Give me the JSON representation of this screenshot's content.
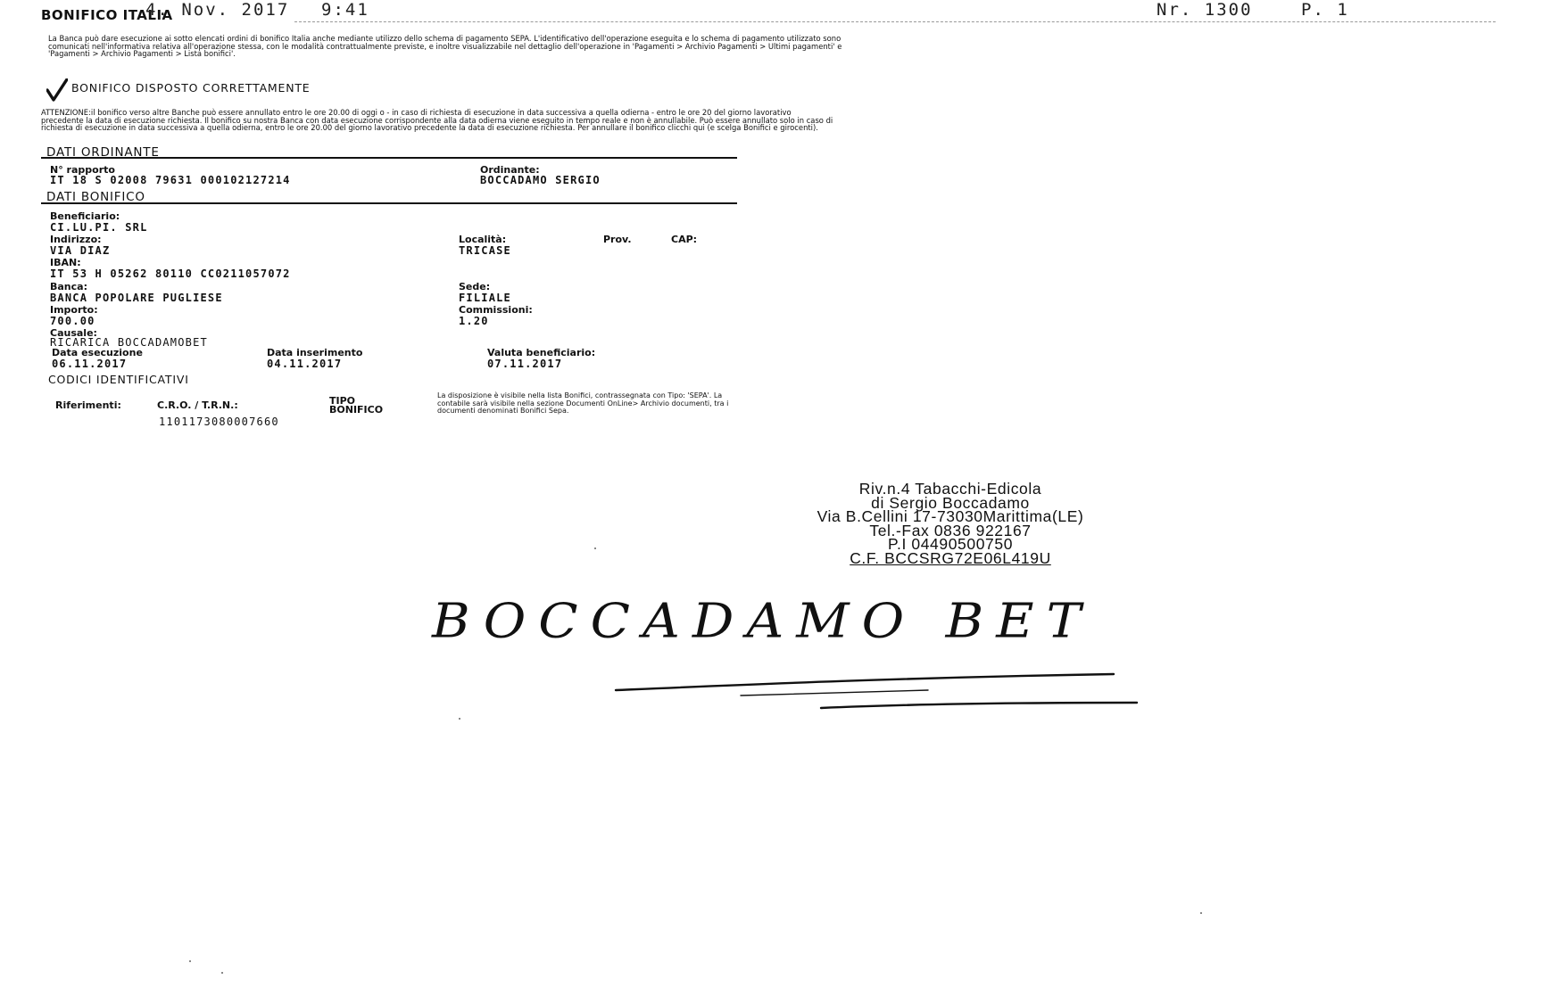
{
  "fax_header": {
    "date": "4. Nov. 2017",
    "time": "9:41",
    "number": "Nr. 1300",
    "page": "P. 1"
  },
  "doc_title": "BONIFICO ITALIA",
  "intro_text": "La Banca può dare esecuzione ai sotto elencati ordini di bonifico Italia anche mediante utilizzo dello schema di pagamento SEPA. L'identificativo dell'operazione eseguita e lo schema di pagamento utilizzato sono comunicati nell'informativa relativa all'operazione stessa, con le modalità contrattualmente previste, e inoltre visualizzabile nel dettaglio dell'operazione in 'Pagamenti > Archivio Pagamenti > Ultimi pagamenti' e 'Pagamenti > Archivio Pagamenti > Lista bonifici'.",
  "status": {
    "icon": "check-icon",
    "text": "BONIFICO DISPOSTO CORRETTAMENTE"
  },
  "warning_text": "ATTENZIONE:il bonifico verso altre Banche può essere annullato entro le ore 20.00 di oggi o - in caso di richiesta di esecuzione in data successiva a quella odierna - entro le ore 20 del giorno lavorativo precedente la data di esecuzione richiesta. Il bonifico su nostra Banca con data esecuzione corrispondente alla data odierna viene eseguito in tempo reale e non è annullabile. Può essere annullato solo in caso di richiesta di esecuzione in data successiva a quella odierna, entro le ore 20.00 del giorno lavorativo precedente la data di esecuzione richiesta. Per annullare il bonifico clicchi qui (e scelga Bonifici e girocenti).",
  "ordinante": {
    "section_title": "DATI ORDINANTE",
    "rapporto_label": "N° rapporto",
    "rapporto_value": "IT 18 S 02008 79631 000102127214",
    "ordinante_label": "Ordinante:",
    "ordinante_value": "BOCCADAMO SERGIO"
  },
  "bonifico": {
    "section_title": "DATI BONIFICO",
    "beneficiario_label": "Beneficiario:",
    "beneficiario_value": "CI.LU.PI. SRL",
    "indirizzo_label": "Indirizzo:",
    "indirizzo_value": "VIA DIAZ",
    "localita_label": "Località:",
    "localita_value": "TRICASE",
    "prov_label": "Prov.",
    "cap_label": "CAP:",
    "iban_label": "IBAN:",
    "iban_value": "IT 53 H 05262 80110 CC0211057072",
    "banca_label": "Banca:",
    "banca_value": "BANCA POPOLARE PUGLIESE",
    "sede_label": "Sede:",
    "sede_value": "FILIALE",
    "importo_label": "Importo:",
    "importo_value": "700.00",
    "commissioni_label": "Commissioni:",
    "commissioni_value": "1.20",
    "causale_label": "Causale:",
    "causale_value": "RICARICA BOCCADAMOBET",
    "data_esecuzione_label": "Data esecuzione",
    "data_esecuzione_value": "06.11.2017",
    "data_inserimento_label": "Data inserimento",
    "data_inserimento_value": "04.11.2017",
    "valuta_label": "Valuta beneficiario:",
    "valuta_value": "07.11.2017"
  },
  "codici": {
    "section_title": "CODICI IDENTIFICATIVI",
    "riferimenti_label": "Riferimenti:",
    "cro_label": "C.R.O. / T.R.N.:",
    "cro_value": "1101173080007660",
    "tipo_label_1": "TIPO",
    "tipo_label_2": "BONIFICO",
    "tipo_note": "La disposizione è visibile nella lista Bonifici, contrassegnata con Tipo: 'SEPA'. La contabile sarà visibile nella sezione Documenti OnLine> Archivio documenti, tra i documenti denominati Bonifici Sepa."
  },
  "stamp": {
    "line1": "Riv.n.4 Tabacchi-Edicola",
    "line2": "di Sergio Boccadamo",
    "line3": "Via B.Cellini 17-73030Marittima(LE)",
    "line4": "Tel.-Fax  0836 922167",
    "line5": "P.I  04490500750",
    "line6": "C.F. BCCSRG72E06L419U"
  },
  "handwriting": "BOCCADAMO BET"
}
